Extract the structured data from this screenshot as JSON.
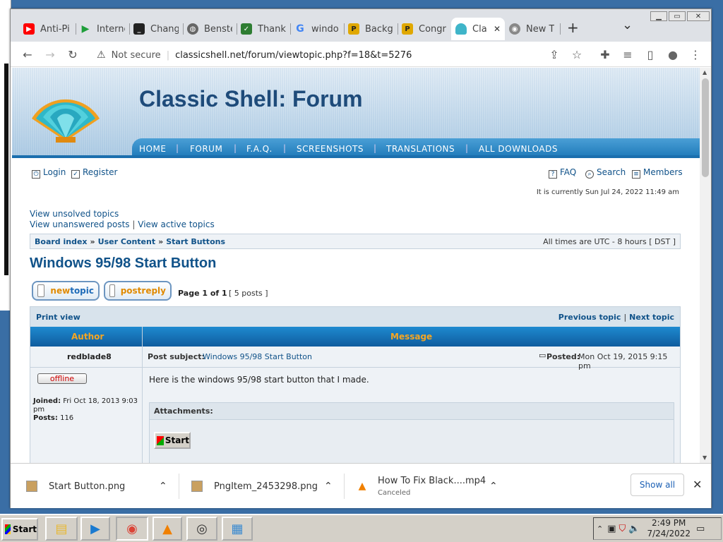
{
  "browser": {
    "tabs": [
      {
        "label": "Anti-Pi",
        "icon": "youtube-icon",
        "color": "#ff0000"
      },
      {
        "label": "Interne",
        "icon": "play-icon",
        "color": "#1e9e3a"
      },
      {
        "label": "Chang",
        "icon": "terminal-icon",
        "color": "#222222"
      },
      {
        "label": "Benste",
        "icon": "globe-icon",
        "color": "#666666"
      },
      {
        "label": "Thank",
        "icon": "check-icon",
        "color": "#2e7d32"
      },
      {
        "label": "windo",
        "icon": "google-icon",
        "color": "#4285f4"
      },
      {
        "label": "Backg",
        "icon": "png-icon",
        "color": "#e0a800"
      },
      {
        "label": "Congr",
        "icon": "png-icon",
        "color": "#e0a800"
      },
      {
        "label": "Cla",
        "icon": "shell-icon",
        "color": "#3fb5c9"
      },
      {
        "label": "New T",
        "icon": "chrome-icon",
        "color": "#888888"
      }
    ],
    "new_tab_symbol": "+",
    "tab_menu_symbol": "⌄",
    "close_tab_symbol": "✕",
    "address": {
      "security": "Not secure",
      "url": "classicshell.net/forum/viewtopic.php?f=18&t=5276"
    }
  },
  "forum": {
    "site_title": "Classic Shell: Forum",
    "nav": [
      "HOME",
      "FORUM",
      "F.A.Q.",
      "SCREENSHOTS",
      "TRANSLATIONS",
      "ALL DOWNLOADS"
    ],
    "nav_sep": "|",
    "login": "Login",
    "register": "Register",
    "faq": "FAQ",
    "search": "Search",
    "members": "Members",
    "current_time": "It is currently Sun Jul 24, 2022 11:49 am",
    "view_unsolved": "View unsolved topics",
    "view_unanswered": "View unanswered posts",
    "view_active": "View active topics",
    "link_sep": "|",
    "breadcrumb": [
      "Board index",
      "User Content",
      "Start Buttons"
    ],
    "breadcrumb_sep": "»",
    "timezone": "All times are UTC - 8 hours [ DST ]",
    "topic_title": "Windows 95/98 Start Button",
    "btn_new_topic_a": "new",
    "btn_new_topic_b": "topic",
    "btn_post_reply_a": "post",
    "btn_post_reply_b": "reply",
    "page_info": "Page 1 of 1",
    "posts_count": "[ 5 posts ]",
    "print_view": "Print view",
    "previous_topic": "Previous topic",
    "next_topic": "Next topic",
    "col_author": "Author",
    "col_message": "Message",
    "post": {
      "author": "redblade8",
      "status": "offline",
      "joined_label": "Joined:",
      "joined": "Fri Oct 18, 2013 9:03 pm",
      "posts_label": "Posts:",
      "posts": "116",
      "subject_label": "Post subject:",
      "subject": "Windows 95/98 Start Button",
      "posted_label": "Posted:",
      "posted": "Mon Oct 19, 2015 9:15 pm",
      "body": "Here is the windows 95/98 start button that I made.",
      "attachments_label": "Attachments:",
      "attachment_btn": "Start"
    }
  },
  "downloads": {
    "items": [
      {
        "name": "Start Button.png",
        "status": ""
      },
      {
        "name": "PngItem_2453298.png",
        "status": ""
      },
      {
        "name": "How To Fix Black....mp4",
        "status": "Canceled"
      }
    ],
    "show_all": "Show all",
    "close_symbol": "✕"
  },
  "taskbar": {
    "start_label": "Start",
    "clock_time": "2:49 PM",
    "clock_date": "7/24/2022"
  }
}
